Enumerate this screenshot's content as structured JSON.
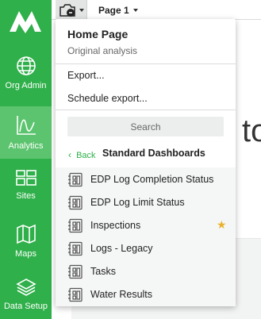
{
  "toolbar": {
    "page_label": "Page 1"
  },
  "sidebar": {
    "items": [
      {
        "label": "Org Admin",
        "icon": "globe-icon"
      },
      {
        "label": "Analytics",
        "icon": "analytics-chart-icon",
        "active": true
      },
      {
        "label": "Sites",
        "icon": "grid-icon"
      },
      {
        "label": "Maps",
        "icon": "map-icon"
      },
      {
        "label": "Data Setup",
        "icon": "layers-icon"
      }
    ]
  },
  "background": {
    "heading_fragment": "to"
  },
  "menu": {
    "title": "Home Page",
    "subtitle": "Original analysis",
    "export_label": "Export...",
    "schedule_export_label": "Schedule export...",
    "search_placeholder": "Search",
    "back_label": "Back",
    "section_title": "Standard Dashboards",
    "dashboards": [
      {
        "label": "EDP Log Completion Status",
        "starred": false
      },
      {
        "label": "EDP Log Limit Status",
        "starred": false
      },
      {
        "label": "Inspections",
        "starred": true
      },
      {
        "label": "Logs - Legacy",
        "starred": false
      },
      {
        "label": "Tasks",
        "starred": false
      },
      {
        "label": "Water Results",
        "starred": false
      }
    ]
  },
  "colors": {
    "brand_green": "#2fb04a",
    "active_nav": "#5cc46e",
    "star": "#e9b22a"
  }
}
